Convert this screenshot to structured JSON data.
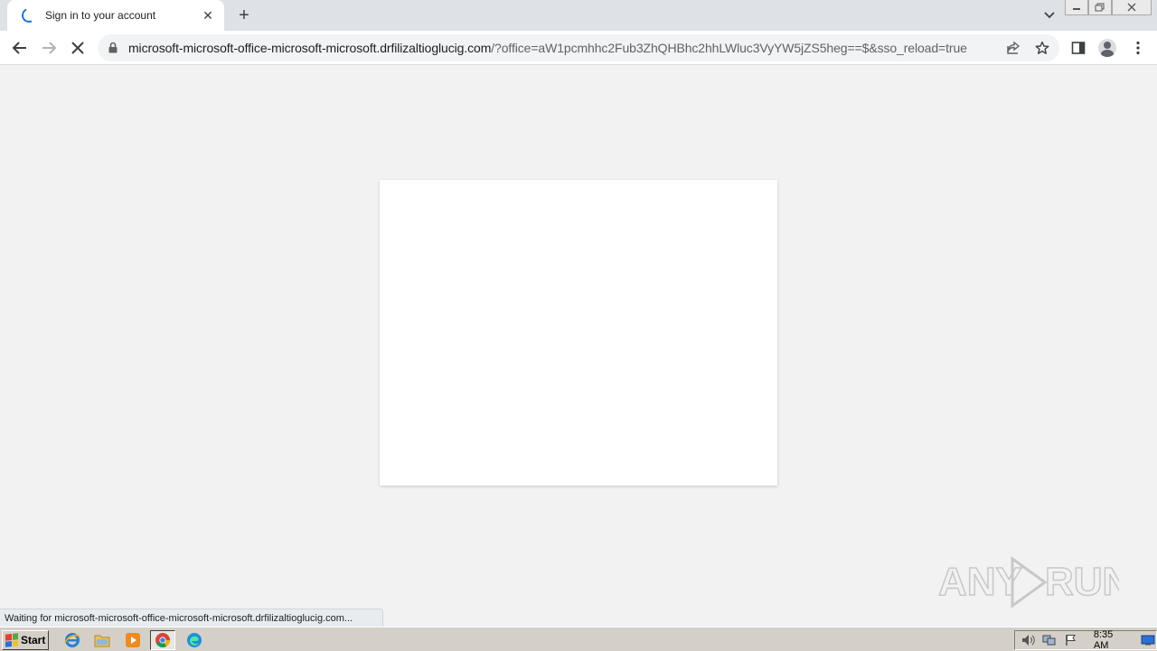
{
  "browser": {
    "tab": {
      "title": "Sign in to your account",
      "close_glyph": "✕"
    },
    "new_tab_glyph": "+",
    "address": {
      "host": "microsoft-microsoft-office-microsoft-microsoft.drfilizaltioglucig.com",
      "rest": "/?office=aW1pcmhhc2Fub3ZhQHBhc2hhLWluc3VyYW5jZS5heg==$&sso_reload=true"
    },
    "status_text": "Waiting for microsoft-microsoft-office-microsoft-microsoft.drfilizaltioglucig.com..."
  },
  "colors": {
    "accent": "#1a73e8",
    "page_bg": "#f2f2f2",
    "card_bg": "#ffffff"
  },
  "watermark": {
    "text": "ANY RUN"
  },
  "taskbar": {
    "start_label": "Start",
    "clock": "8:35 AM"
  }
}
